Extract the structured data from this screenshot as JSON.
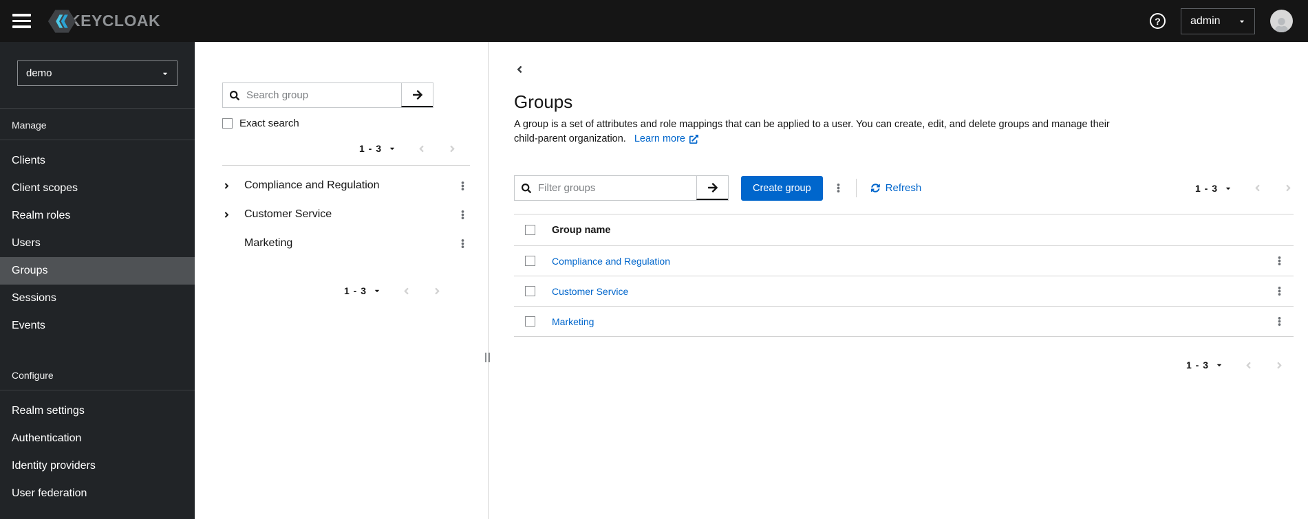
{
  "topbar": {
    "brand": "KEYCLOAK",
    "user": "admin"
  },
  "sidebar": {
    "realm": "demo",
    "manage_label": "Manage",
    "manage_items": [
      "Clients",
      "Client scopes",
      "Realm roles",
      "Users",
      "Groups",
      "Sessions",
      "Events"
    ],
    "configure_label": "Configure",
    "configure_items": [
      "Realm settings",
      "Authentication",
      "Identity providers",
      "User federation"
    ],
    "selected_item": "Groups"
  },
  "tree": {
    "search_placeholder": "Search group",
    "exact_search": "Exact search",
    "pagination_top": "1 - 3",
    "pagination_bottom": "1 - 3",
    "items": [
      {
        "label": "Compliance and Regulation",
        "expandable": true
      },
      {
        "label": "Customer Service",
        "expandable": true
      },
      {
        "label": "Marketing",
        "expandable": false
      }
    ]
  },
  "main": {
    "title": "Groups",
    "description_line1": "A group is a set of attributes and role mappings that can be applied to a user. You can create, edit, and delete groups and manage their",
    "description_line2": "child-parent organization.",
    "learn_more": "Learn more",
    "toolbar": {
      "filter_placeholder": "Filter groups",
      "create_button": "Create group",
      "refresh": "Refresh",
      "pagination": "1 - 3"
    },
    "table": {
      "header": "Group name",
      "rows": [
        "Compliance and Regulation",
        "Customer Service",
        "Marketing"
      ]
    },
    "pagination_bottom": "1 - 3"
  },
  "colors": {
    "primary": "#0066cc",
    "link": "#0066cc",
    "masthead_bg": "#151515",
    "sidebar_bg": "#212427",
    "sidebar_selected_bg": "#4f5255",
    "border": "#d2d2d2",
    "text": "#151515",
    "muted_text": "#6a6e73"
  }
}
